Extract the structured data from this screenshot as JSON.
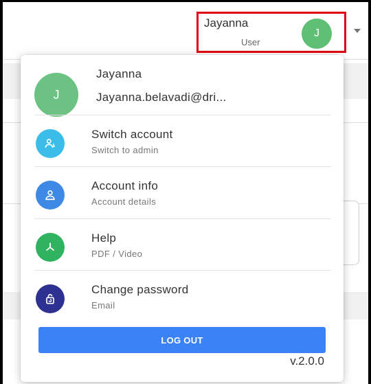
{
  "header": {
    "user_name": "Jayanna",
    "user_role": "User",
    "avatar_initial": "J"
  },
  "menu": {
    "profile": {
      "avatar_initial": "J",
      "name": "Jayanna",
      "email": "Jayanna.belavadi@dri..."
    },
    "items": [
      {
        "title": "Switch account",
        "subtitle": "Switch to admin",
        "icon": "switch-account-icon",
        "color": "#3bbde9"
      },
      {
        "title": "Account info",
        "subtitle": "Account details",
        "icon": "account-info-icon",
        "color": "#3f89e6"
      },
      {
        "title": "Help",
        "subtitle": "PDF / Video",
        "icon": "help-icon",
        "color": "#2fb35e"
      },
      {
        "title": "Change password",
        "subtitle": "Email",
        "icon": "change-password-icon",
        "color": "#2e3192"
      }
    ],
    "logout_label": "LOG OUT",
    "version": "v.2.0.0"
  },
  "colors": {
    "highlight_border": "#e3000f",
    "avatar_green": "#5fbf74",
    "logout_blue": "#3b82f6"
  }
}
